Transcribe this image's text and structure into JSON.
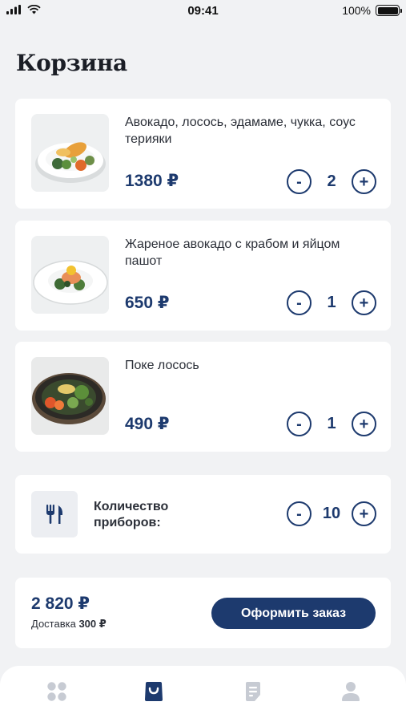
{
  "status_bar": {
    "time": "09:41",
    "battery": "100%"
  },
  "page": {
    "title": "Корзина"
  },
  "cart_items": [
    {
      "name": "Авокадо, лосось, эдамаме, чукка, соус терияки",
      "price": "1380 ₽",
      "quantity": "2",
      "image": "avocado-salmon-bowl-photo"
    },
    {
      "name": "Жареное авокадо с крабом и яйцом пашот",
      "price": "650 ₽",
      "quantity": "1",
      "image": "fried-avocado-crab-egg-photo"
    },
    {
      "name": "Поке лосось",
      "price": "490 ₽",
      "quantity": "1",
      "image": "poke-salmon-photo"
    }
  ],
  "stepper": {
    "minus": "-",
    "plus": "+"
  },
  "cutlery": {
    "label": "Количество приборов:",
    "quantity": "10",
    "icon": "cutlery-icon"
  },
  "summary": {
    "total": "2 820 ₽",
    "delivery_label": "Доставка",
    "delivery_price": "300 ₽",
    "order_button": "Оформить заказ"
  },
  "tab_bar": {
    "tabs": [
      {
        "name": "menu",
        "icon": "grid-icon",
        "active": false
      },
      {
        "name": "cart",
        "icon": "bag-icon",
        "active": true
      },
      {
        "name": "orders",
        "icon": "receipt-icon",
        "active": false
      },
      {
        "name": "profile",
        "icon": "person-icon",
        "active": false
      }
    ]
  },
  "colors": {
    "accent": "#1d3a6e",
    "background": "#f1f2f4",
    "card": "#ffffff",
    "inactive_icon": "#c7cbd3"
  }
}
